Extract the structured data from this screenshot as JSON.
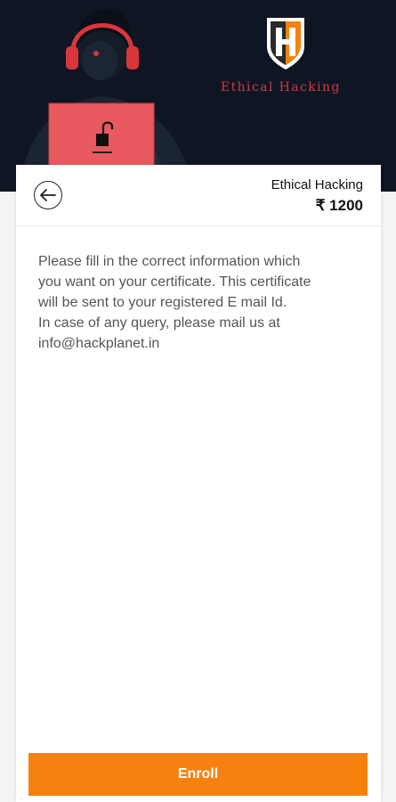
{
  "header": {
    "brand_text": "Ethical Hacking",
    "logo_icon": "shield-h-logo-icon",
    "illustration": "hooded-hacker-with-laptop-icon",
    "accent_color": "#d8353c",
    "background_color": "#0e1624"
  },
  "course": {
    "title": "Ethical Hacking",
    "price": "₹ 1200"
  },
  "info": {
    "line1": "Please fill in the correct information which",
    "line2": "you want on your certificate. This certificate",
    "line3": "will be sent to your registered E mail Id.",
    "line4": "In case of any query, please mail us at",
    "line5": "info@hackplanet.in"
  },
  "actions": {
    "back_icon": "arrow-left-icon",
    "enroll_label": "Enroll",
    "enroll_color": "#f5820f"
  }
}
